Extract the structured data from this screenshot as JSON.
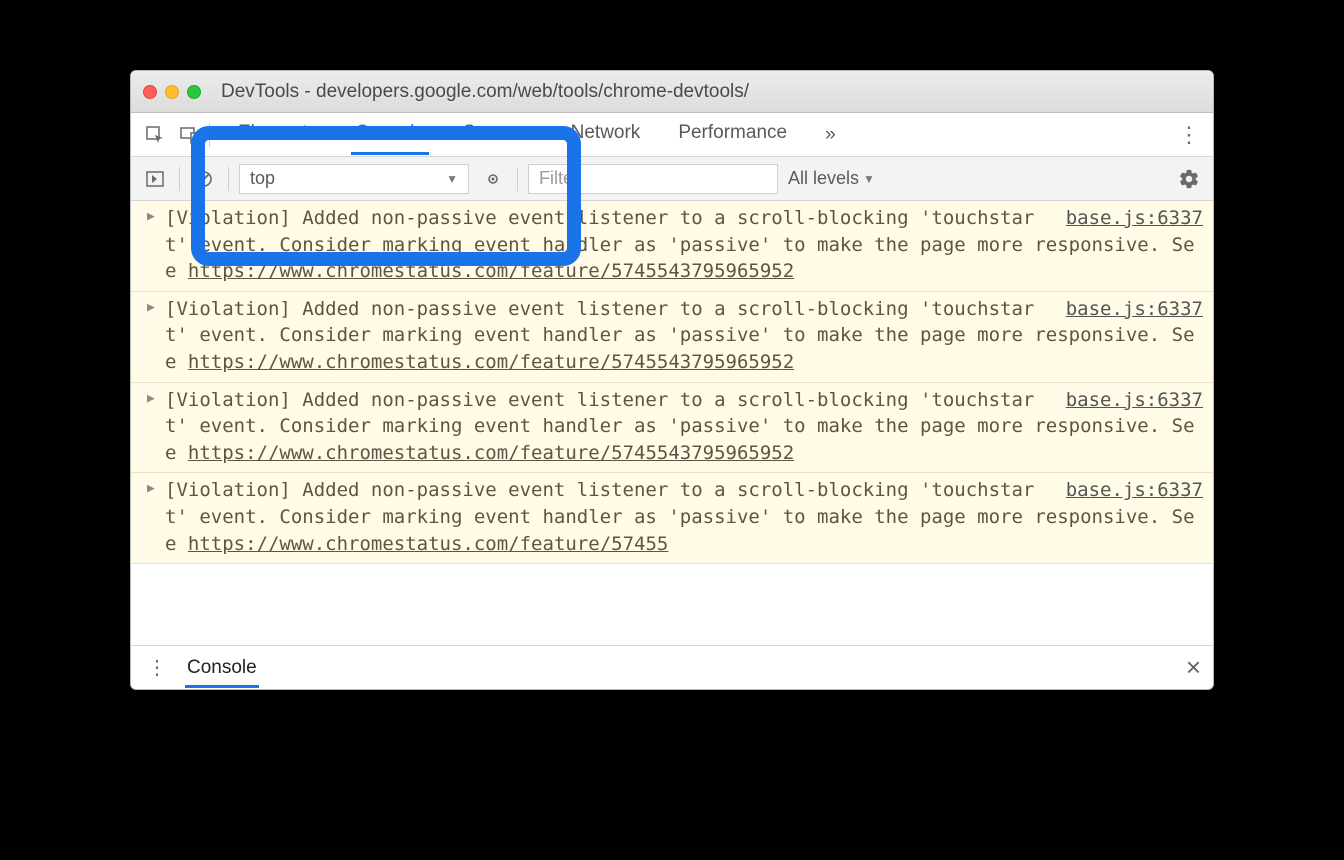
{
  "window": {
    "title": "DevTools - developers.google.com/web/tools/chrome-devtools/"
  },
  "tabs": {
    "items": [
      "Elements",
      "Console",
      "Sources",
      "Network",
      "Performance"
    ],
    "overflow": "»"
  },
  "toolbar": {
    "context": "top",
    "filter_placeholder": "Filter",
    "levels": "All levels"
  },
  "messages": [
    {
      "text_a": "[Violation] Added non-passive event listener to a scroll-blocking 'touchstart' event. Consider marking event handler as 'passive' to make the page more responsive. See ",
      "link": "https://www.chromestatus.com/feature/5745543795965952",
      "source": "base.js:6337"
    },
    {
      "text_a": "[Violation] Added non-passive event listener to a scroll-blocking 'touchstart' event. Consider marking event handler as 'passive' to make the page more responsive. See ",
      "link": "https://www.chromestatus.com/feature/5745543795965952",
      "source": "base.js:6337"
    },
    {
      "text_a": "[Violation] Added non-passive event listener to a scroll-blocking 'touchstart' event. Consider marking event handler as 'passive' to make the page more responsive. See ",
      "link": "https://www.chromestatus.com/feature/5745543795965952",
      "source": "base.js:6337"
    },
    {
      "text_a": "[Violation] Added non-passive event listener to a scroll-blocking 'touchstart' event. Consider marking event handler as 'passive' to make the page more responsive. See ",
      "link": "https://www.chromestatus.com/feature/57455",
      "source": "base.js:6337"
    }
  ],
  "drawer": {
    "tab": "Console"
  }
}
